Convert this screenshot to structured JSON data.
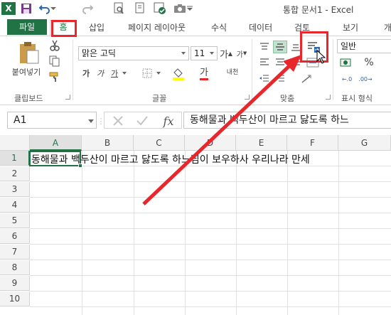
{
  "title": "통합 문서1 - Excel",
  "app_logo": "X",
  "quick_access": [
    "save-icon",
    "undo-icon",
    "redo-icon",
    "print-preview-icon",
    "touch-mode-icon",
    "camera-icon"
  ],
  "tabs": {
    "file": "파일",
    "home": "홈",
    "others": [
      "삽입",
      "페이지 레이아웃",
      "수식",
      "데이터",
      "검토",
      "보기",
      "개"
    ]
  },
  "ribbon": {
    "clipboard": {
      "paste_label": "붙여넣기",
      "group_label": "클립보드"
    },
    "font": {
      "font_name": "맑은 고딕",
      "font_size": "11",
      "grow": "가",
      "shrink": "가",
      "bold": "가",
      "italic": "가",
      "underline": "가",
      "font_color_letter": "가",
      "phonetic": "내천",
      "group_label": "글꼴"
    },
    "alignment": {
      "group_label": "맞춤"
    },
    "number": {
      "format": "일반",
      "percent": "%",
      "group_label": "표시 형식"
    }
  },
  "formula_bar": {
    "name_box": "A1",
    "fx": "fx",
    "content": "동해물과 백두산이 마르고 닳도록 하느"
  },
  "grid": {
    "columns": [
      "A",
      "B",
      "C",
      "D",
      "E",
      "F",
      "G"
    ],
    "rows": [
      "1",
      "2",
      "3",
      "4",
      "5",
      "6",
      "7",
      "8",
      "9",
      "10"
    ],
    "a1_value": "동해물과 백두산이 마르고 닳도록 하느님이 보우하사 우리나라 만세"
  },
  "colors": {
    "accent": "#217346",
    "annotation": "#e8262b"
  }
}
